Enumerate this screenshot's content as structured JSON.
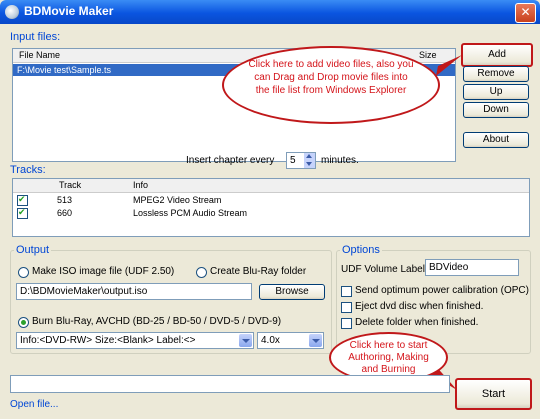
{
  "window": {
    "title": "BDMovie Maker",
    "close_glyph": "✕"
  },
  "input_files": {
    "group_label": "Input files:",
    "columns": [
      "File Name",
      "Size"
    ],
    "rows": [
      {
        "name": "F:\\Movie test\\Sample.ts",
        "size": ""
      }
    ]
  },
  "side_buttons": {
    "add": "Add",
    "remove": "Remove",
    "up": "Up",
    "down": "Down",
    "about": "About"
  },
  "callout_add": "Click here to add video files, also you can Drag and Drop movie files into the file list from Windows Explorer",
  "chapter": {
    "prefix": "Insert chapter every",
    "value": "5",
    "suffix": "minutes."
  },
  "tracks": {
    "group_label": "Tracks:",
    "columns": [
      "Track",
      "Info"
    ],
    "rows": [
      {
        "checked": true,
        "track": "513",
        "info": "MPEG2 Video Stream"
      },
      {
        "checked": true,
        "track": "660",
        "info": "Lossless PCM Audio Stream"
      }
    ]
  },
  "output": {
    "group_label": "Output",
    "iso_label": "Make ISO image file (UDF 2.50)",
    "bluray_folder_label": "Create Blu-Ray folder",
    "path": "D:\\BDMovieMaker\\output.iso",
    "browse": "Browse",
    "burn_label": "Burn Blu-Ray, AVCHD (BD-25 / BD-50 / DVD-5 / DVD-9)",
    "drive_info": "Info:<DVD-RW> Size:<Blank> Label:<>",
    "speed": "4.0x"
  },
  "options": {
    "group_label": "Options",
    "udf_label": "UDF Volume Label",
    "udf_value": "BDVideo",
    "checks": [
      {
        "label": "Send optimum power calibration (OPC)",
        "checked": false
      },
      {
        "label": "Eject dvd disc when finished.",
        "checked": false
      },
      {
        "label": "Delete folder when finished.",
        "checked": false
      }
    ]
  },
  "callout_start": "Click here to start Authoring, Making and Burning",
  "start": "Start",
  "open_file": "Open file...",
  "colors": {
    "accent": "#0046d5",
    "callout": "#d4141a",
    "title_bar": "#0a55e0"
  }
}
